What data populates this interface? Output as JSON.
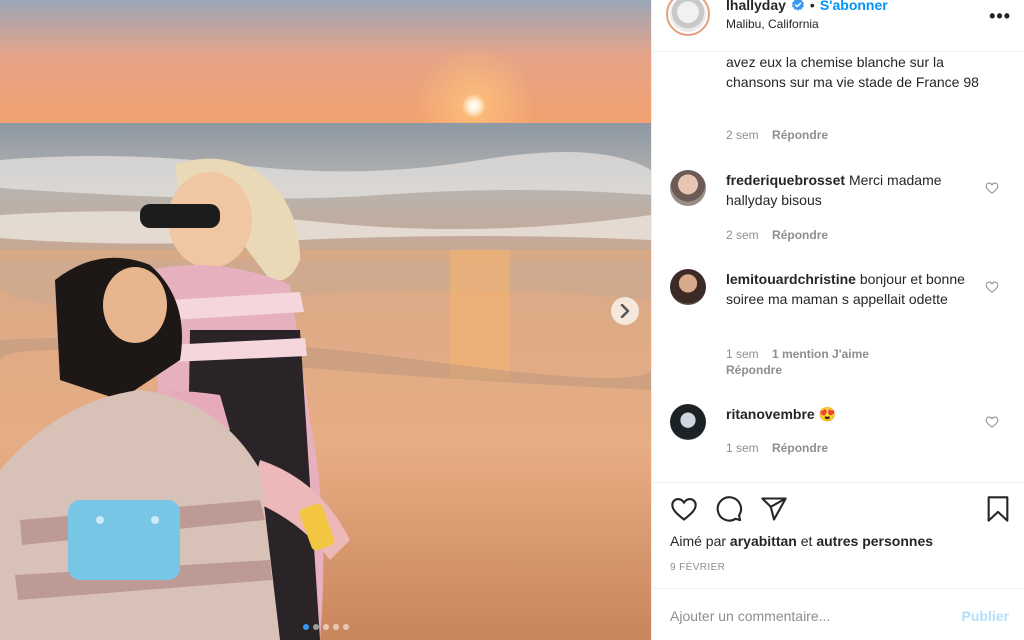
{
  "post": {
    "username": "lhallyday",
    "verified_icon": "verified-badge-icon",
    "separator": "•",
    "follow_label": "S'abonner",
    "location": "Malibu, California",
    "more_icon": "more-options-icon",
    "more_glyph": "•••"
  },
  "media": {
    "description_icon": "beach-sunset-photo",
    "next_icon": "chevron-right-icon",
    "dots_total": 5,
    "dots_active_index": 0
  },
  "comments": [
    {
      "username": "",
      "text": "avez eux la chemise blanche sur la chansons sur ma vie stade de France 98",
      "time": "2 sem",
      "reply_label": "Répondre"
    },
    {
      "username": "frederiquebrosset",
      "text": "Merci madame hallyday bisous",
      "time": "2 sem",
      "reply_label": "Répondre"
    },
    {
      "username": "lemitouardchristine",
      "text": "bonjour et bonne soiree ma maman s appellait odette",
      "time": "1 sem",
      "likes_label": "1 mention J'aime",
      "reply_label": "Répondre"
    },
    {
      "username": "ritanovembre",
      "emoji": "😍",
      "time": "1 sem",
      "reply_label": "Répondre"
    }
  ],
  "actions": {
    "like_icon": "heart-icon",
    "comment_icon": "comment-icon",
    "share_icon": "share-icon",
    "save_icon": "bookmark-icon",
    "liked_prefix": "Aimé par",
    "liked_user": "aryabittan",
    "liked_and": "et",
    "liked_others": "autres personnes",
    "date": "9 FÉVRIER"
  },
  "add_comment": {
    "placeholder": "Ajouter un commentaire...",
    "publish_label": "Publier"
  },
  "colors": {
    "accent": "#0095f6",
    "publish_disabled": "#b2dffc",
    "muted": "#8e8e8e",
    "text": "#262626",
    "border": "#efefef"
  }
}
